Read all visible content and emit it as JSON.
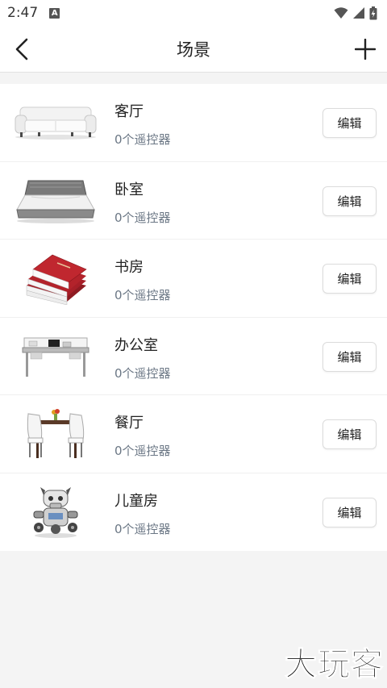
{
  "status_bar": {
    "time": "2:47",
    "notification_badge": "A"
  },
  "header": {
    "title": "场景"
  },
  "scenes": [
    {
      "name": "客厅",
      "count_text": "0个遥控器",
      "edit_label": "编辑",
      "image": "sofa-image"
    },
    {
      "name": "卧室",
      "count_text": "0个遥控器",
      "edit_label": "编辑",
      "image": "bed-image"
    },
    {
      "name": "书房",
      "count_text": "0个遥控器",
      "edit_label": "编辑",
      "image": "books-image"
    },
    {
      "name": "办公室",
      "count_text": "0个遥控器",
      "edit_label": "编辑",
      "image": "desk-image"
    },
    {
      "name": "餐厅",
      "count_text": "0个遥控器",
      "edit_label": "编辑",
      "image": "dining-table-image"
    },
    {
      "name": "儿童房",
      "count_text": "0个遥控器",
      "edit_label": "编辑",
      "image": "toy-robot-image"
    }
  ],
  "watermark": "大玩客",
  "colors": {
    "accent_text": "#6b7785",
    "background": "#f4f4f4",
    "book_red": "#b3232b"
  }
}
